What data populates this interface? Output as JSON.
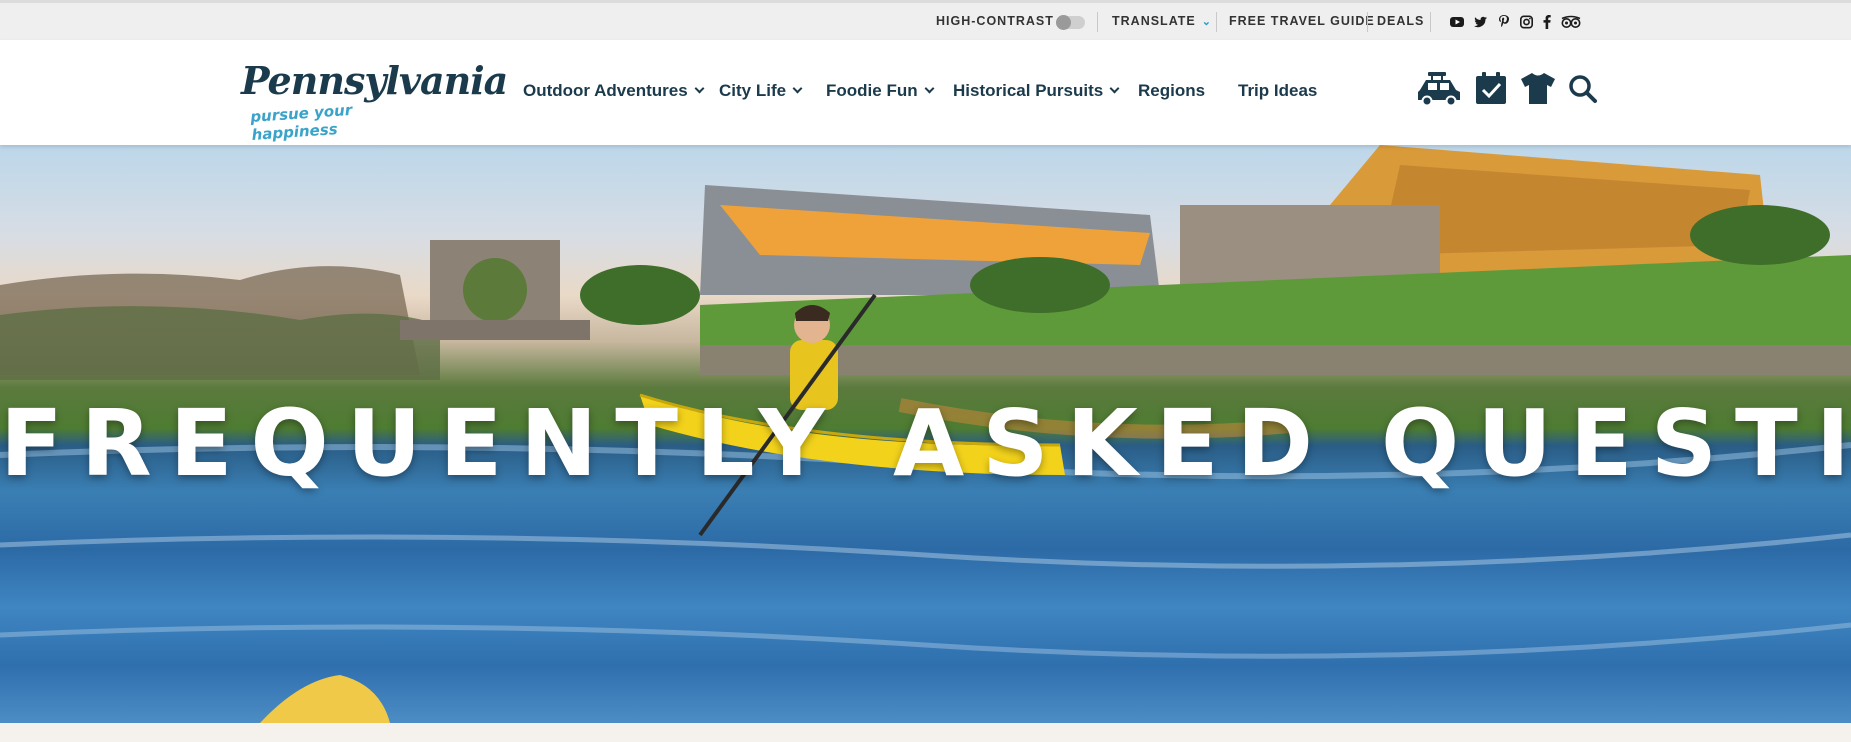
{
  "utility_bar": {
    "high_contrast_label": "HIGH-CONTRAST",
    "translate_label": "TRANSLATE",
    "free_travel_guide_label": "FREE TRAVEL GUIDE",
    "deals_label": "DEALS",
    "social_icons": [
      "youtube-icon",
      "twitter-icon",
      "pinterest-icon",
      "instagram-icon",
      "facebook-icon",
      "tripadvisor-icon"
    ]
  },
  "header": {
    "logo_text": "Pennsylvania",
    "logo_tagline": "pursue your happiness",
    "nav": [
      {
        "label": "Outdoor Adventures",
        "has_dropdown": true
      },
      {
        "label": "City Life",
        "has_dropdown": true
      },
      {
        "label": "Foodie Fun",
        "has_dropdown": true
      },
      {
        "label": "Historical Pursuits",
        "has_dropdown": true
      },
      {
        "label": "Regions",
        "has_dropdown": false
      },
      {
        "label": "Trip Ideas",
        "has_dropdown": false
      }
    ],
    "icons": [
      "car-icon",
      "calendar-check-icon",
      "tshirt-icon",
      "search-icon"
    ]
  },
  "hero": {
    "title": "FREQUENTLY ASKED QUESTIONS"
  },
  "colors": {
    "brand_navy": "#1b3a4b",
    "brand_blue": "#3aa3c9",
    "utility_bg": "#efefef"
  }
}
